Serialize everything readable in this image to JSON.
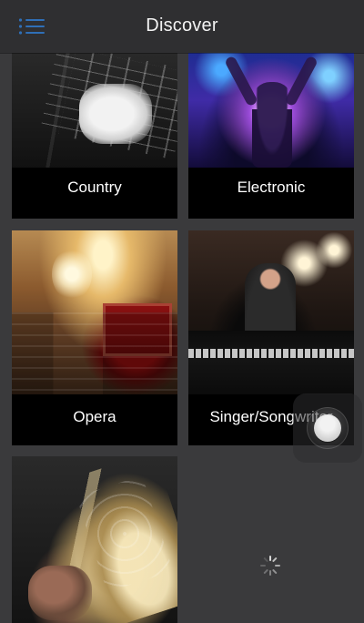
{
  "header": {
    "title": "Discover",
    "menu_icon": "menu-list-icon"
  },
  "genres": [
    {
      "label": "Country",
      "icon": "guitar-photo"
    },
    {
      "label": "Electronic",
      "icon": "concert-photo"
    },
    {
      "label": "Opera",
      "icon": "opera-house-photo"
    },
    {
      "label": "Singer/Songwriter",
      "icon": "pianist-photo"
    },
    {
      "label": "",
      "icon": "saxophone-photo"
    }
  ],
  "status": {
    "loading_icon": "spinner-icon"
  },
  "colors": {
    "header_bg": "#2f2f31",
    "page_bg": "#3a3a3c",
    "tile_bg": "#000000",
    "menu_accent": "#2f6fb7",
    "text": "#ffffff"
  }
}
